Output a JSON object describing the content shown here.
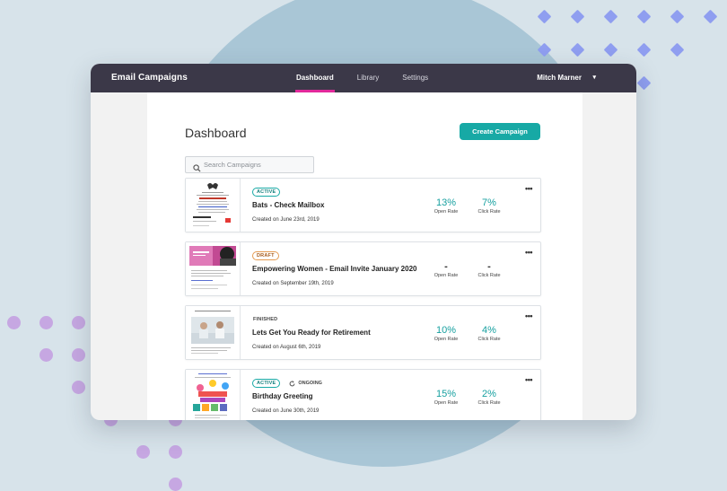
{
  "app": {
    "title": "Email Campaigns"
  },
  "nav": [
    {
      "label": "Dashboard",
      "active": true
    },
    {
      "label": "Library",
      "active": false
    },
    {
      "label": "Settings",
      "active": false
    }
  ],
  "user": {
    "name": "Mitch Marner",
    "caret": "▾"
  },
  "page": {
    "title": "Dashboard",
    "create_label": "Create Campaign"
  },
  "search": {
    "placeholder": "Search Campaigns"
  },
  "campaigns": [
    {
      "status": "ACTIVE",
      "extra": "",
      "name": "Bats - Check Mailbox",
      "created": "Created on June 23rd, 2019",
      "open_rate": "13%",
      "click_rate": "7%",
      "open_label": "Open Rate",
      "click_label": "Click Rate",
      "more": "•••"
    },
    {
      "status": "DRAFT",
      "extra": "",
      "name": "Empowering Women - Email Invite January 2020",
      "created": "Created on September 19th, 2019",
      "open_rate": "-",
      "click_rate": "-",
      "open_label": "Open Rate",
      "click_label": "Click Rate",
      "more": "•••"
    },
    {
      "status": "FINISHED",
      "extra": "",
      "name": "Lets Get You Ready for Retirement",
      "created": "Created on August 6th, 2019",
      "open_rate": "10%",
      "click_rate": "4%",
      "open_label": "Open Rate",
      "click_label": "Click Rate",
      "more": "•••"
    },
    {
      "status": "ACTIVE",
      "extra": "ONGOING",
      "name": "Birthday Greeting",
      "created": "Created on June 30th, 2019",
      "open_rate": "15%",
      "click_rate": "2%",
      "open_label": "Open Rate",
      "click_label": "Click Rate",
      "more": "•••"
    }
  ],
  "colors": {
    "accent": "#17a9a5",
    "nav_active": "#e2299a",
    "topbar": "#3b3848",
    "draft": "#e49b52"
  }
}
